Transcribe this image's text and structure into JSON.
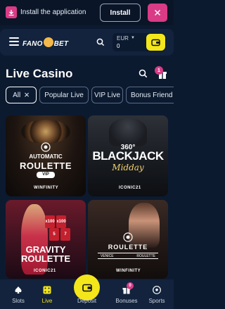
{
  "install_bar": {
    "text": "Install the application",
    "button_label": "Install"
  },
  "header": {
    "logo_left": "FANO",
    "logo_right": "BET",
    "currency": "EUR",
    "balance": "0"
  },
  "page": {
    "title": "Live Casino",
    "gift_badge": "1"
  },
  "chips": [
    {
      "label": "All",
      "active": true
    },
    {
      "label": "Popular Live",
      "active": false
    },
    {
      "label": "VIP Live",
      "active": false
    },
    {
      "label": "Bonus Friend",
      "active": false
    }
  ],
  "games": [
    {
      "line1": "AUTOMATIC",
      "line2": "ROULETTE",
      "badge": "VIP",
      "provider": "WINFINITY"
    },
    {
      "line1": "360°",
      "line2": "BLACKJACK",
      "line3": "Midday",
      "provider": "ICONIC21"
    },
    {
      "line1": "GRAVITY",
      "line2": "ROULETTE",
      "multipliers": [
        "x100",
        "x100",
        "5",
        "7"
      ],
      "provider": "ICONIC21"
    },
    {
      "line1": "ROULETTE",
      "sub_left": "VENICE",
      "sub_right": "ROULETTE",
      "provider": "WINFINITY"
    }
  ],
  "bottom_nav": {
    "slots": "Slots",
    "live": "Live",
    "deposit": "Deposit",
    "bonuses": "Bonuses",
    "bonuses_badge": "0",
    "sports": "Sports"
  },
  "colors": {
    "background": "#0c1a30",
    "accent_yellow": "#f3e61b",
    "accent_pink": "#d93b86"
  }
}
